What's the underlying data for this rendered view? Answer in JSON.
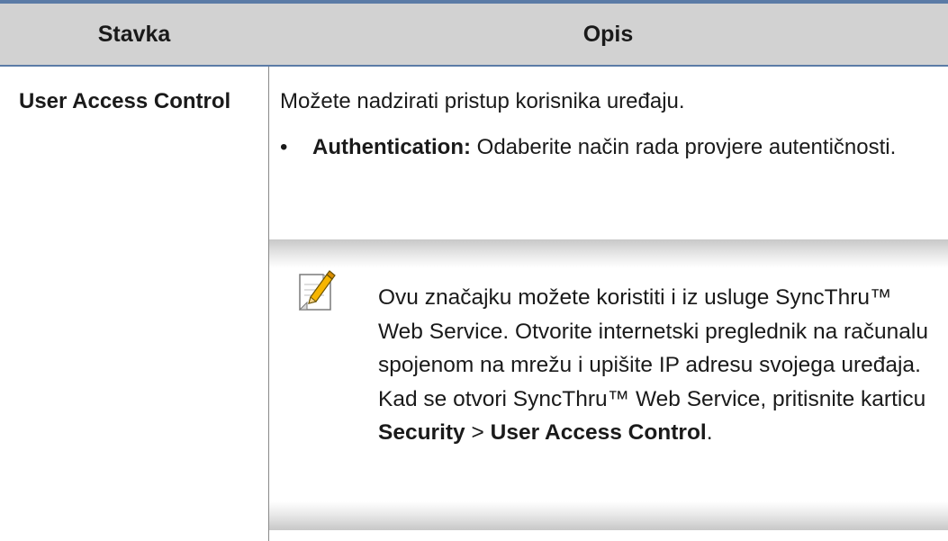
{
  "table": {
    "headers": {
      "item": "Stavka",
      "description": "Opis"
    },
    "row": {
      "item_name": "User Access Control",
      "description": "Možete nadzirati pristup korisnika uređaju.",
      "bullet": {
        "label": "Authentication:",
        "text": "Odaberite način rada provjere autentičnosti."
      },
      "note": {
        "icon": "note-pencil-icon",
        "text_intro": "Ovu značajku možete koristiti i iz usluge SyncThru™ Web Service. Otvorite internetski preglednik na računalu spojenom na mrežu i upišite IP adresu svojega uređaja. Kad se otvori SyncThru™ Web Service, pritisnite karticu",
        "path_part1": "Security",
        "path_separator": ">",
        "path_part2": "User Access Control",
        "path_end": "."
      }
    }
  },
  "colors": {
    "header_background": "#d2d2d2",
    "rule_blue": "#5b7ba6"
  }
}
